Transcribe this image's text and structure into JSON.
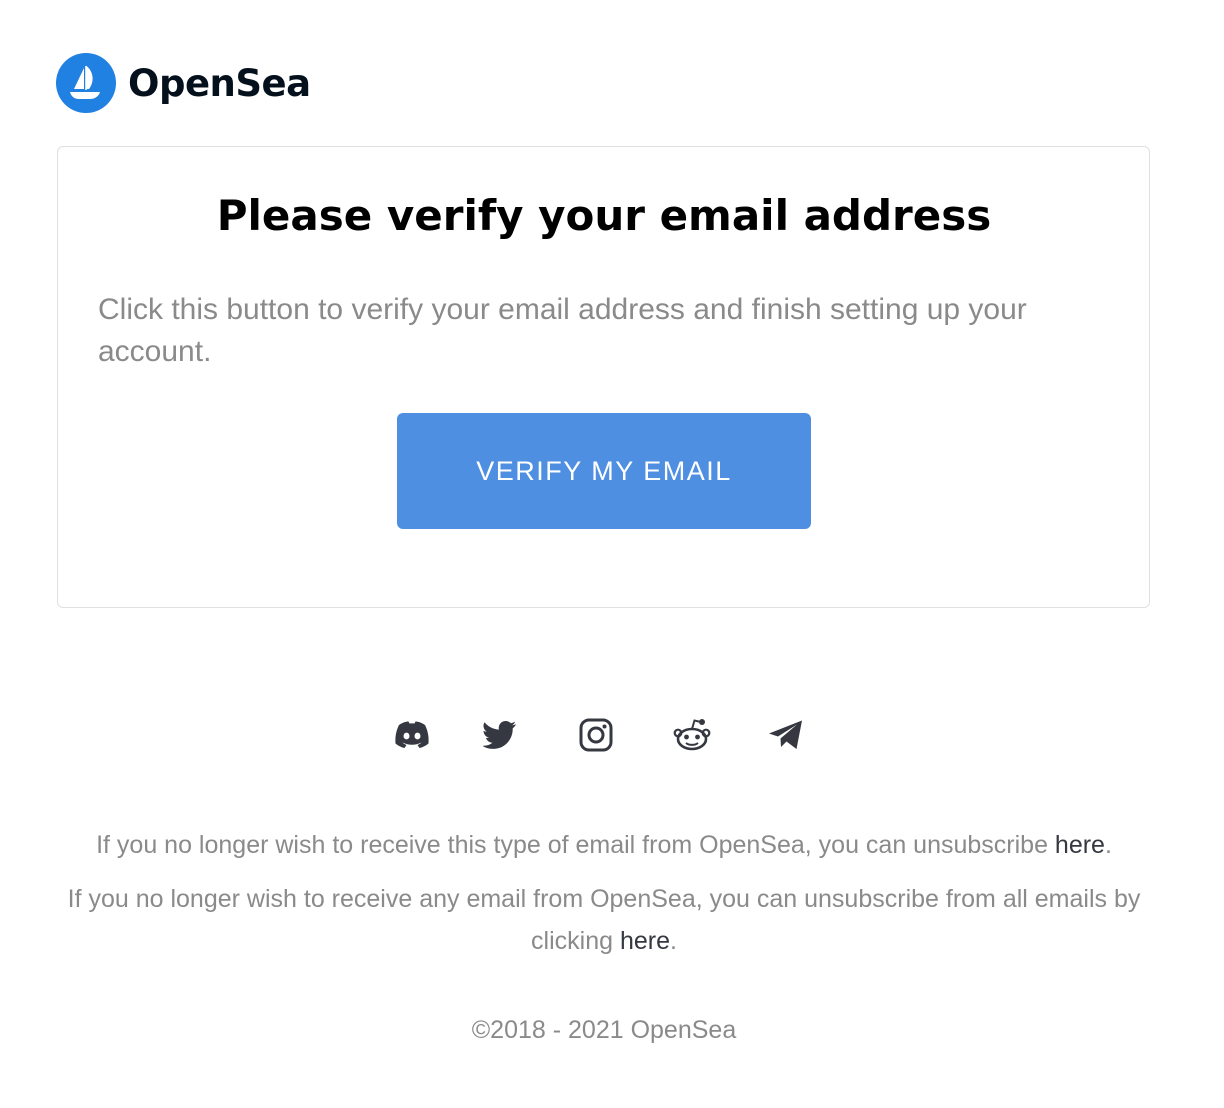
{
  "brand": {
    "name": "OpenSea",
    "logo_icon": "opensea-ship-icon",
    "logo_color": "#2081e2"
  },
  "card": {
    "title": "Please verify your email address",
    "body": "Click this button to verify your email address and finish setting up your account.",
    "button_label": "VERIFY MY EMAIL",
    "button_color": "#4f8fe1"
  },
  "social": {
    "icons": [
      "discord-icon",
      "twitter-icon",
      "instagram-icon",
      "reddit-icon",
      "telegram-icon"
    ],
    "icon_color": "#353840"
  },
  "footer": {
    "unsubscribe_type_text": "If you no longer wish to receive this type of email from OpenSea, you can unsubscribe ",
    "unsubscribe_type_link": "here",
    "unsubscribe_all_text": "If you no longer wish to receive any email from OpenSea, you can unsubscribe from all emails by clicking ",
    "unsubscribe_all_link": "here",
    "period": ".",
    "copyright": "©2018 - 2021 OpenSea",
    "text_color": "#8a8a8a"
  }
}
